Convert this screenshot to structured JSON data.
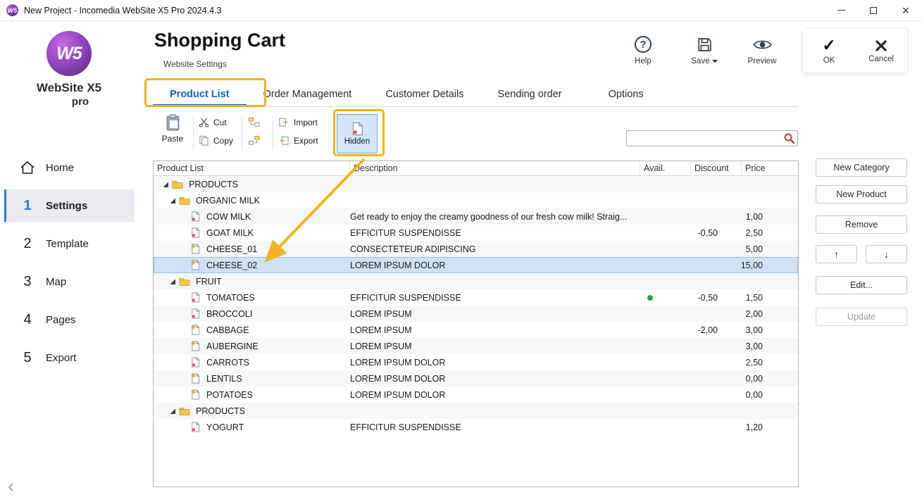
{
  "window": {
    "title": "New Project - Incomedia WebSite X5 Pro 2024.4.3"
  },
  "icons": {
    "check": "✓",
    "question": "?",
    "close": "×"
  },
  "sidebar": {
    "logo": {
      "monogram": "W5",
      "brand": "WebSite X5",
      "edition": "pro"
    },
    "items": [
      {
        "label": "Home",
        "icon": "home",
        "selected": false
      },
      {
        "number": "1",
        "label": "Settings",
        "selected": true
      },
      {
        "number": "2",
        "label": "Template",
        "selected": false
      },
      {
        "number": "3",
        "label": "Map",
        "selected": false
      },
      {
        "number": "4",
        "label": "Pages",
        "selected": false
      },
      {
        "number": "5",
        "label": "Export",
        "selected": false
      }
    ]
  },
  "header": {
    "title": "Shopping Cart",
    "subtitle": "Website Settings",
    "help_label": "Help",
    "save_label": "Save",
    "preview_label": "Preview",
    "ok_label": "OK",
    "cancel_label": "Cancel"
  },
  "tabs": [
    {
      "label": "Product List",
      "selected": true,
      "annotated": true
    },
    {
      "label": "Order Management",
      "selected": false
    },
    {
      "label": "Customer Details",
      "selected": false
    },
    {
      "label": "Sending order",
      "selected": false
    },
    {
      "label": "Options",
      "selected": false,
      "gap_before": true
    }
  ],
  "toolbar": {
    "paste_label": "Paste",
    "cut_label": "Cut",
    "copy_label": "Copy",
    "import_label": "Import",
    "export_label": "Export",
    "hidden_label": "Hidden",
    "hidden_active": true,
    "search": {
      "value": "",
      "placeholder": ""
    }
  },
  "product_table": {
    "columns": [
      "Product List",
      "Description",
      "Avail.",
      "Discount",
      "Price"
    ],
    "rows": [
      {
        "type": "category",
        "level": 0,
        "label": "PRODUCTS",
        "expanded": true
      },
      {
        "type": "category",
        "level": 1,
        "label": "ORGANIC MILK",
        "expanded": true
      },
      {
        "type": "product",
        "level": 2,
        "label": "COW MILK",
        "icon": "plain",
        "description": "Get ready to enjoy the creamy goodness of our fresh cow milk! Straig...",
        "discount": "",
        "price": "1,00"
      },
      {
        "type": "product",
        "level": 2,
        "label": "GOAT MILK",
        "icon": "plain",
        "description": "EFFICITUR SUSPENDISSE",
        "discount": "-0,50",
        "price": "2,50"
      },
      {
        "type": "product",
        "level": 2,
        "label": "CHEESE_01",
        "icon": "starred",
        "description": "CONSECTETEUR ADIPISCING",
        "discount": "",
        "price": "5,00"
      },
      {
        "type": "product",
        "level": 2,
        "label": "CHEESE_02",
        "icon": "starred",
        "description": "LOREM IPSUM DOLOR",
        "discount": "",
        "price": "15,00",
        "selected": true
      },
      {
        "type": "category",
        "level": 1,
        "label": "FRUIT",
        "expanded": true
      },
      {
        "type": "product",
        "level": 2,
        "label": "TOMATOES",
        "icon": "plain",
        "description": "EFFICITUR SUSPENDISSE",
        "available": true,
        "discount": "-0,50",
        "price": "1,50"
      },
      {
        "type": "product",
        "level": 2,
        "label": "BROCCOLI",
        "icon": "plain",
        "description": "LOREM IPSUM",
        "discount": "",
        "price": "2,00"
      },
      {
        "type": "product",
        "level": 2,
        "label": "CABBAGE",
        "icon": "starred",
        "description": "LOREM IPSUM",
        "discount": "-2,00",
        "price": "3,00"
      },
      {
        "type": "product",
        "level": 2,
        "label": "AUBERGINE",
        "icon": "starred",
        "description": "LOREM IPSUM",
        "discount": "",
        "price": "3,00"
      },
      {
        "type": "product",
        "level": 2,
        "label": "CARROTS",
        "icon": "plain",
        "description": "LOREM IPSUM DOLOR",
        "discount": "",
        "price": "2,50"
      },
      {
        "type": "product",
        "level": 2,
        "label": "LENTILS",
        "icon": "starred",
        "description": "LOREM IPSUM DOLOR",
        "discount": "",
        "price": "0,00"
      },
      {
        "type": "product",
        "level": 2,
        "label": "POTATOES",
        "icon": "starred",
        "description": "LOREM IPSUM DOLOR",
        "discount": "",
        "price": "0,00"
      },
      {
        "type": "category",
        "level": 1,
        "label": "PRODUCTS",
        "expanded": true
      },
      {
        "type": "product",
        "level": 2,
        "label": "YOGURT",
        "icon": "plain",
        "description": "EFFICITUR SUSPENDISSE",
        "discount": "",
        "price": "1,20"
      }
    ]
  },
  "side_buttons": [
    {
      "label": "New Category",
      "name": "new-category-button"
    },
    {
      "label": "New Product",
      "name": "new-product-button"
    },
    {
      "label": "Remove",
      "name": "remove-button"
    },
    {
      "label": "↑",
      "name": "move-up-button",
      "arrow": true
    },
    {
      "label": "↓",
      "name": "move-down-button",
      "arrow": true
    },
    {
      "label": "Edit...",
      "name": "edit-button"
    },
    {
      "label": "Update",
      "name": "update-button",
      "disabled": true
    }
  ],
  "colors": {
    "accent_blue": "#1464c0",
    "annotation_yellow": "#efb41e",
    "selected_row_bg": "#cfe2f5",
    "available_green": "#2f9e44"
  }
}
